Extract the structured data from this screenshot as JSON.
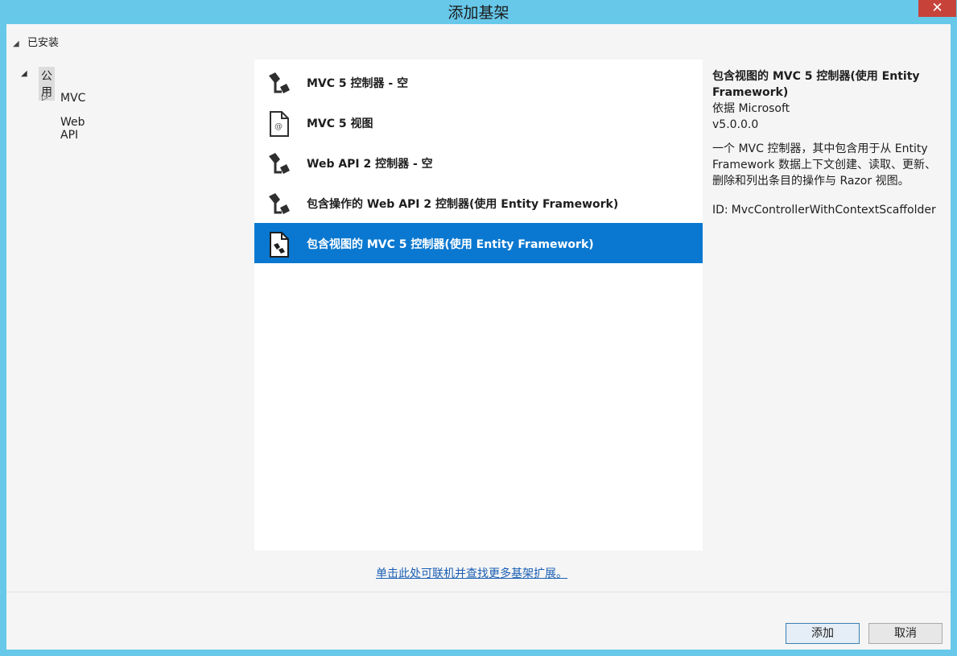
{
  "window": {
    "title": "添加基架",
    "close_glyph": "✕"
  },
  "sidebar": {
    "installed_label": "已安装",
    "tree": [
      {
        "label": "公用",
        "expanded": true,
        "selected": true
      },
      {
        "label": "MVC",
        "expanded": false
      },
      {
        "label": "Web API"
      }
    ]
  },
  "templates": [
    {
      "label": "MVC 5 控制器 - 空",
      "icon": "controller-icon"
    },
    {
      "label": "MVC 5 视图",
      "icon": "view-file-icon"
    },
    {
      "label": "Web API 2 控制器 - 空",
      "icon": "controller-icon"
    },
    {
      "label": "包含操作的 Web API 2 控制器(使用 Entity Framework)",
      "icon": "controller-icon"
    },
    {
      "label": "包含视图的 MVC 5 控制器(使用 Entity Framework)",
      "icon": "controller-view-icon",
      "selected": true
    }
  ],
  "details": {
    "title": "包含视图的 MVC 5 控制器(使用 Entity Framework)",
    "author": "依据 Microsoft",
    "version": "v5.0.0.0",
    "description": "一个 MVC 控制器，其中包含用于从 Entity Framework 数据上下文创建、读取、更新、删除和列出条目的操作与 Razor 视图。",
    "id_label": "ID:",
    "id_value": "MvcControllerWithContextScaffolder"
  },
  "online_link": "单击此处可联机并查找更多基架扩展。",
  "buttons": {
    "add": "添加",
    "cancel": "取消"
  },
  "colors": {
    "title_bar": "#67c8ea",
    "selection": "#0a78d0",
    "close": "#c7433a"
  }
}
